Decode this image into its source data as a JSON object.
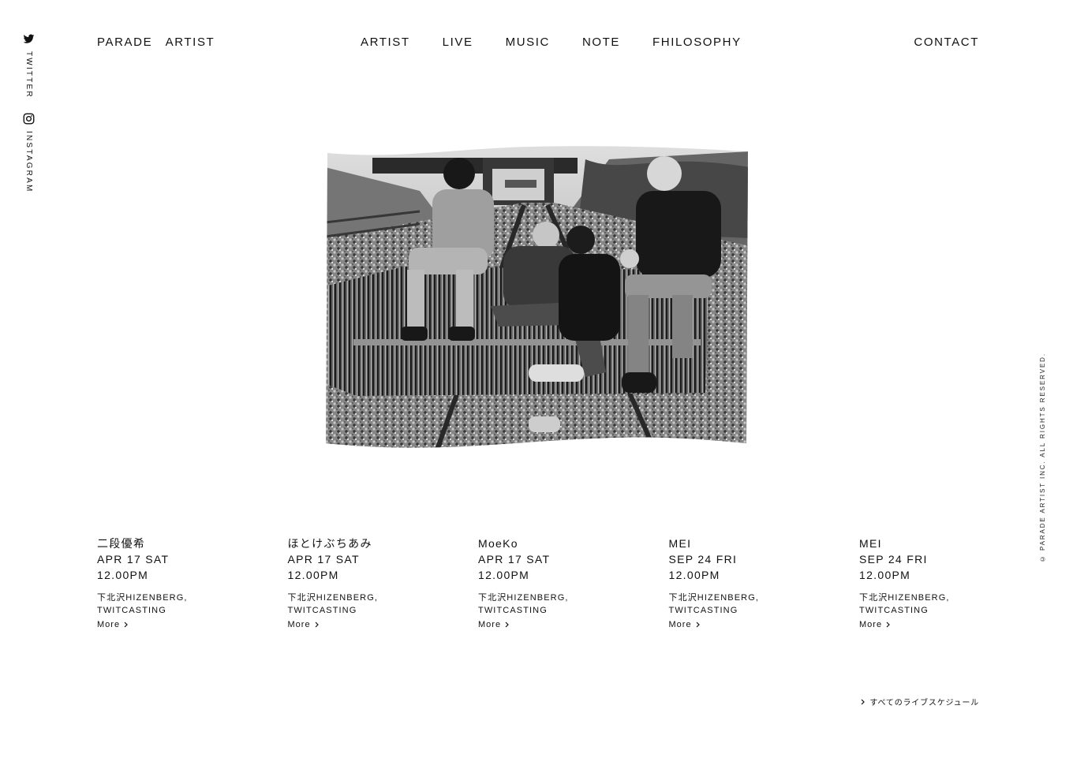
{
  "social": {
    "twitter": {
      "label": "TWITTER",
      "icon": "twitter-icon"
    },
    "instagram": {
      "label": "INSTAGRAM",
      "icon": "instagram-icon"
    }
  },
  "header": {
    "logo": "PARADE   ARTIST",
    "nav": [
      "ARTIST",
      "LIVE",
      "MUSIC",
      "NOTE",
      "FHILOSOPHY"
    ],
    "contact": "CONTACT"
  },
  "hero": {
    "image": "black-and-white band photo: four musicians on a striped sofa on railway tracks"
  },
  "schedule": {
    "events": [
      {
        "artist": "二段優希",
        "date": "APR 17 SAT",
        "time": "12.00PM",
        "venue": "下北沢HIZENBERG, TWITCASTING",
        "more": "More"
      },
      {
        "artist": "ほとけぶちあみ",
        "date": "APR 17 SAT",
        "time": "12.00PM",
        "venue": "下北沢HIZENBERG, TWITCASTING",
        "more": "More"
      },
      {
        "artist": "MoeKo",
        "date": "APR 17 SAT",
        "time": "12.00PM",
        "venue": "下北沢HIZENBERG, TWITCASTING",
        "more": "More"
      },
      {
        "artist": "MEI",
        "date": "SEP 24 FRI",
        "time": "12.00PM",
        "venue": "下北沢HIZENBERG, TWITCASTING",
        "more": "More"
      },
      {
        "artist": "MEI",
        "date": "SEP 24 FRI",
        "time": "12.00PM",
        "venue": "下北沢HIZENBERG, TWITCASTING",
        "more": "More"
      }
    ],
    "all_link": "すべてのライブスケジュール"
  },
  "copyright": "© PARADE ARTIST INC. ALL RIGHTS RESERVED.",
  "colors": {
    "text": "#111111",
    "background": "#ffffff"
  }
}
